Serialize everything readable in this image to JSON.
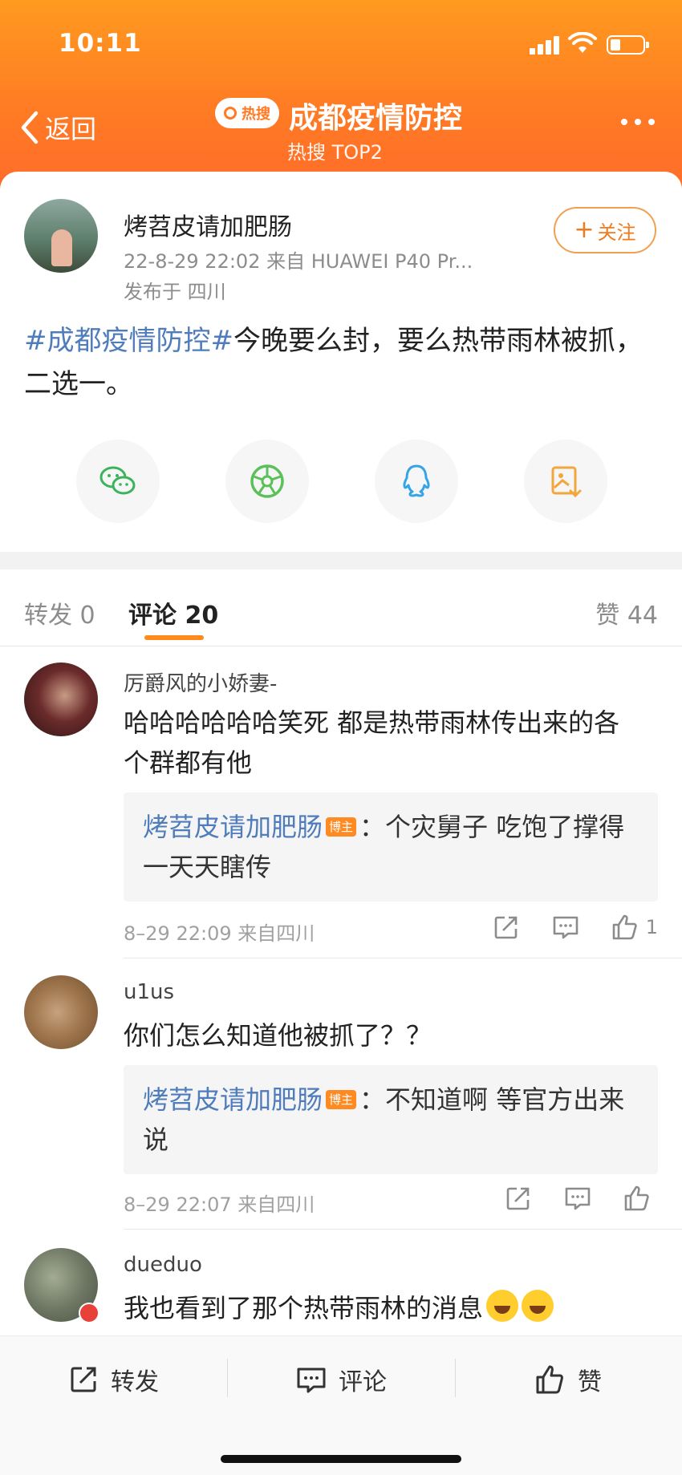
{
  "status": {
    "time": "10:11"
  },
  "header": {
    "back_label": "返回",
    "hot_badge": "热搜",
    "title": "成都疫情防控",
    "subtitle": "热搜 TOP2"
  },
  "post": {
    "author": "烤苕皮请加肥肠",
    "meta": "22-8-29 22:02  来自 HUAWEI P40 Pr...",
    "location": "发布于 四川",
    "follow_label": "关注",
    "hashtag": "#成都疫情防控#",
    "text": "今晚要么封，要么热带雨林被抓，二选一。"
  },
  "share_icons": [
    "wechat-icon",
    "moments-icon",
    "qq-icon",
    "save-image-icon"
  ],
  "tabs": {
    "repost": "转发 0",
    "comment": "评论 20",
    "like": "赞 44"
  },
  "comments": [
    {
      "name": "厉爵风的小娇妻-",
      "text": "哈哈哈哈哈哈笑死 都是热带雨林传出来的各个群都有他",
      "reply_name": "烤苕皮请加肥肠",
      "reply_badge": "博主",
      "reply_text": "：个灾舅子 吃饱了撑得一天天瞎传",
      "meta": "8–29 22:09  来自四川",
      "likes": "1"
    },
    {
      "name": "u1us",
      "text": "你们怎么知道他被抓了？？",
      "reply_name": "烤苕皮请加肥肠",
      "reply_badge": "博主",
      "reply_text": "：不知道啊  等官方出来说",
      "meta": "8–29 22:07  来自四川",
      "likes": ""
    },
    {
      "name": "dueduo",
      "text": "我也看到了那个热带雨林的消息"
    }
  ],
  "bottom_bar": {
    "repost": "转发",
    "comment": "评论",
    "like": "赞"
  },
  "colors": {
    "header_orange": "#ff7b24",
    "link_blue": "#4f7cba",
    "accent_orange": "#ff8a1e"
  }
}
